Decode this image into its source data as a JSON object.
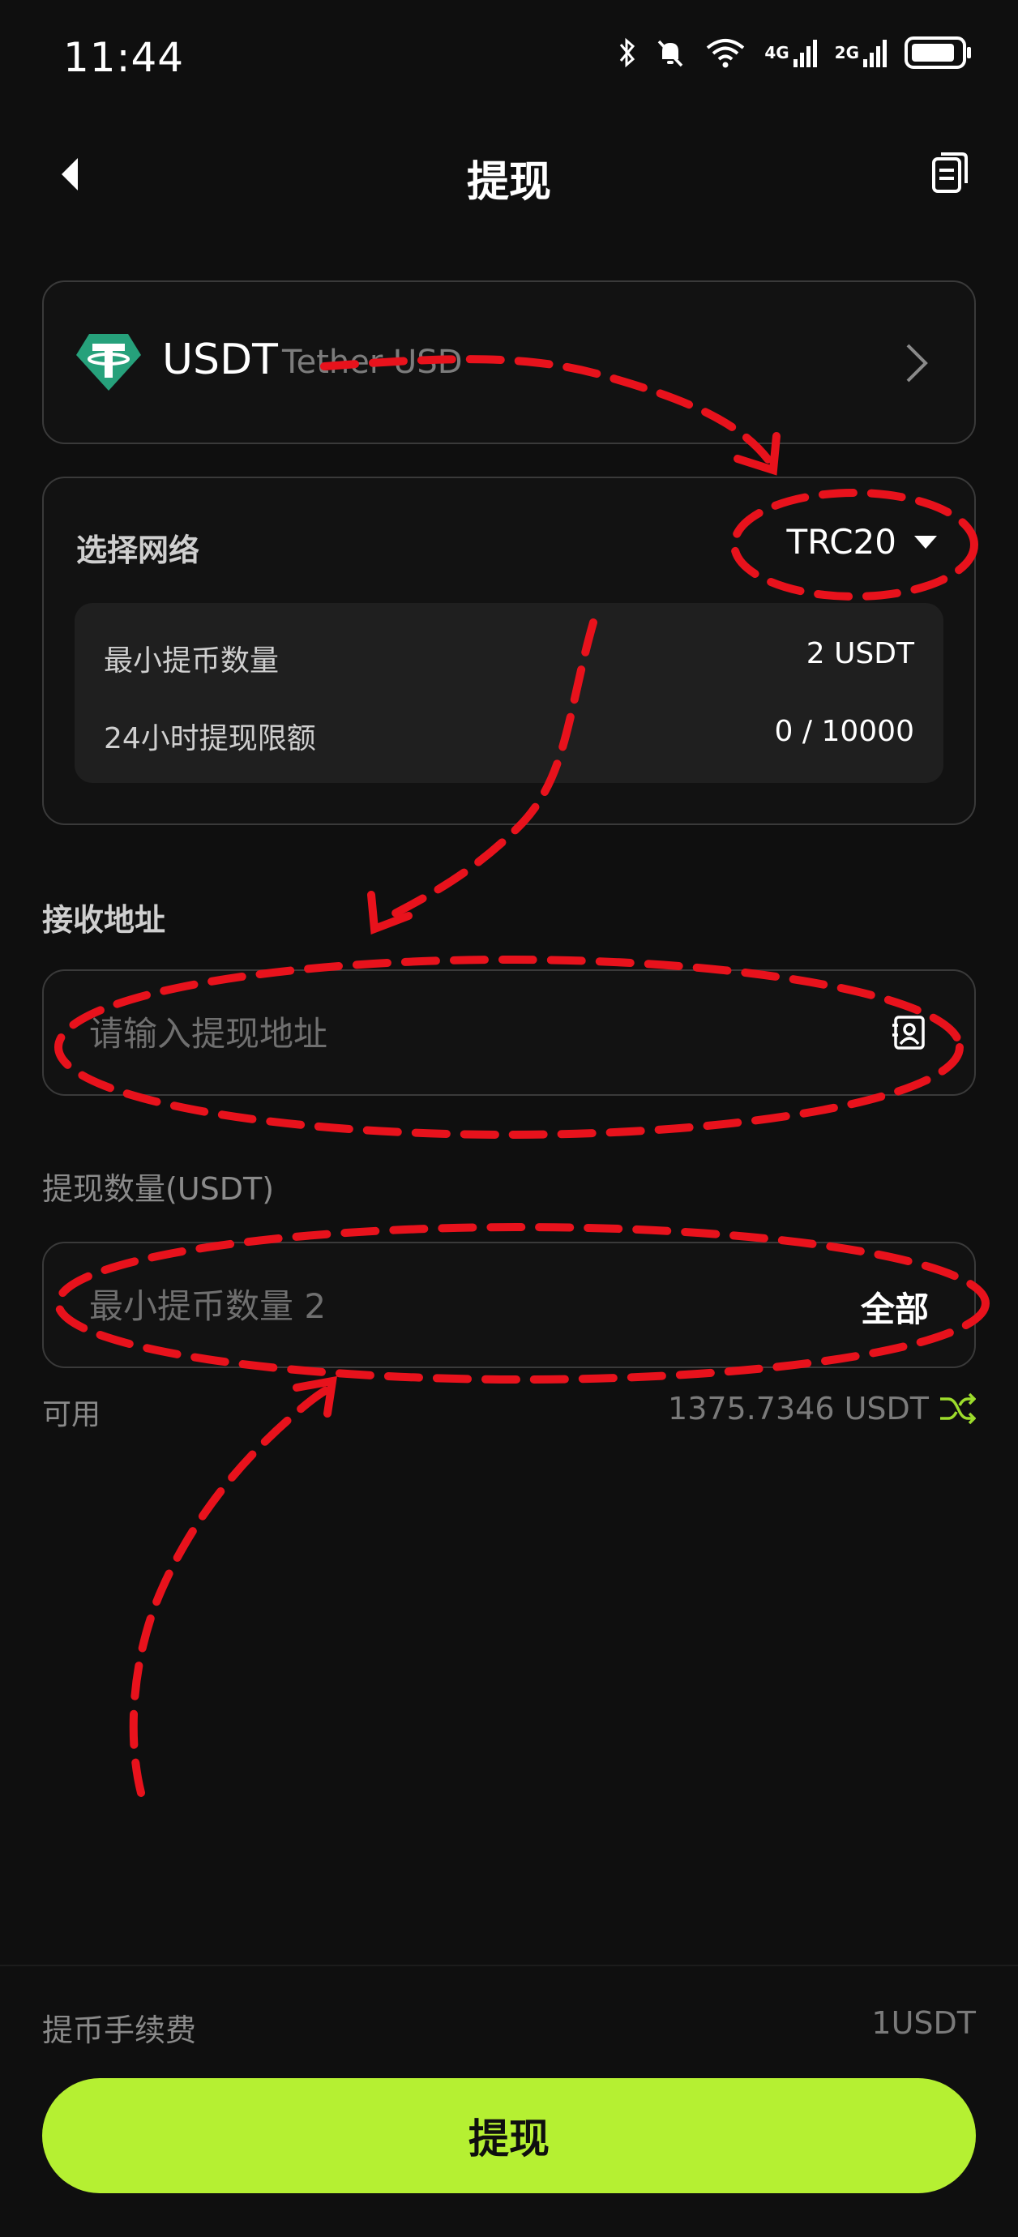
{
  "status_bar": {
    "time": "11:44",
    "net1": "4G",
    "net2": "2G"
  },
  "header": {
    "title": "提现",
    "back_icon": "chevron-left-icon",
    "records_icon": "document-list-icon"
  },
  "coin": {
    "symbol": "USDT",
    "name": "Tether USD",
    "logo_color": "#26a17b"
  },
  "network": {
    "label": "选择网络",
    "selected": "TRC20",
    "limits": [
      {
        "label": "最小提币数量",
        "value": "2 USDT"
      },
      {
        "label": "24小时提现限额",
        "value": "0 / 10000"
      }
    ]
  },
  "address": {
    "label": "接收地址",
    "placeholder": "请输入提现地址"
  },
  "amount": {
    "label": "提现数量(USDT)",
    "placeholder": "最小提币数量 2",
    "all_label": "全部"
  },
  "available": {
    "label": "可用",
    "value": "1375.7346 USDT"
  },
  "fee": {
    "label": "提币手续费",
    "value": "1USDT"
  },
  "submit_label": "提现",
  "colors": {
    "accent": "#b5f032",
    "annotation": "#e8121c",
    "background": "#0f0f0f"
  }
}
